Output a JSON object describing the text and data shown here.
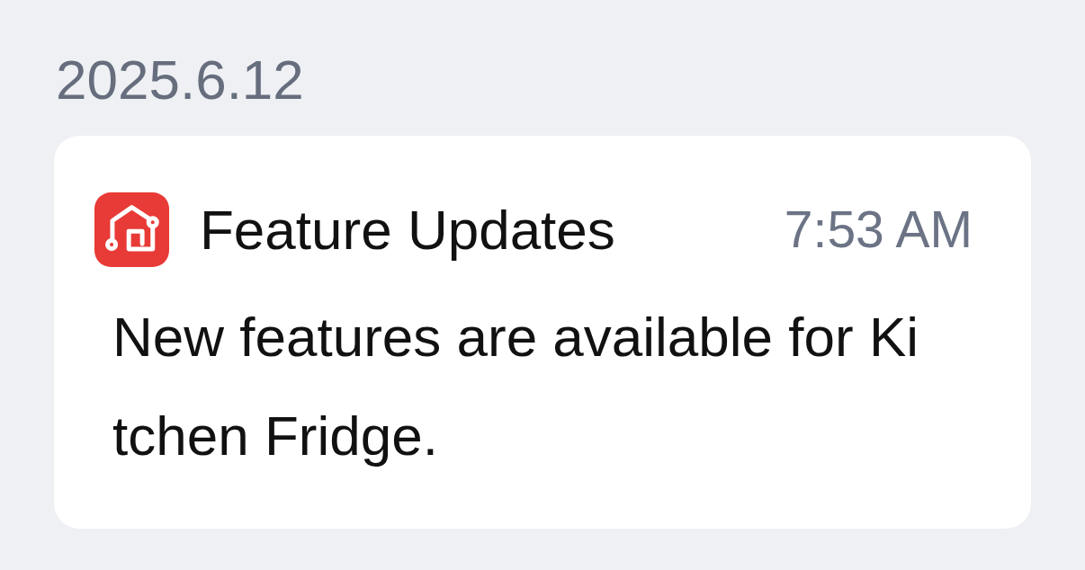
{
  "date": "2025.6.12",
  "notification": {
    "app_title": "Feature Updates",
    "time": "7:53 AM",
    "message": "New features are available for Kitchen Fridge."
  }
}
